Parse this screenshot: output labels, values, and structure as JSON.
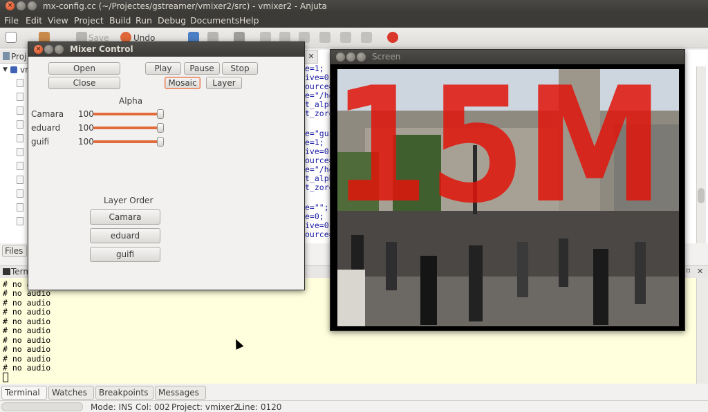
{
  "window": {
    "title": "mx-config.cc (~/Projectes/gstreamer/vmixer2/src) - vmixer2 - Anjuta"
  },
  "menu": [
    "File",
    "Edit",
    "View",
    "Project",
    "Build",
    "Run",
    "Debug",
    "Documents",
    "Help"
  ],
  "toolbar": {
    "save_label": "Save",
    "undo_label": "Undo"
  },
  "project_pane": {
    "header_label": "Proj",
    "root_label": "vm",
    "files_tab": "Files"
  },
  "editor": {
    "tab_close": "✕",
    "lines": [
      "e=1;",
      "ive=0;",
      "ource=",
      "e=\"/ho",
      "t_alph",
      "t_zoro",
      "",
      "e=\"gui",
      "e=1;",
      "ive=0;",
      "ource=",
      "e=\"/ho",
      "t_alph",
      "t_zoro",
      "",
      "e=\"\";",
      "e=0;",
      "ive=0;",
      "ource="
    ]
  },
  "terminal": {
    "header_label": "Termi",
    "lines": [
      "# no a",
      "# no audio",
      "# no audio",
      "# no audio",
      "# no audio",
      "# no audio",
      "# no audio",
      "# no audio",
      "# no audio",
      "# no audio"
    ]
  },
  "bottom_tabs": [
    "Terminal",
    "Watches",
    "Breakpoints",
    "Messages"
  ],
  "status": {
    "mode": "Mode: INS",
    "col": "Col: 002",
    "project": "Project: vmixer2",
    "line": "Line: 0120"
  },
  "mixer": {
    "title": "Mixer Control",
    "buttons": {
      "open": "Open",
      "close": "Close",
      "play": "Play",
      "pause": "Pause",
      "stop": "Stop",
      "mosaic": "Mosaic",
      "layer": "Layer"
    },
    "alpha_title": "Alpha",
    "channels": [
      {
        "name": "Camara",
        "value": "100",
        "level": 1.0
      },
      {
        "name": "eduard",
        "value": "100",
        "level": 1.0
      },
      {
        "name": "guifi",
        "value": "100",
        "level": 1.0
      }
    ],
    "layer_order_title": "Layer Order",
    "layers": [
      "Camara",
      "eduard",
      "guifi"
    ]
  },
  "screen": {
    "title": "Screen",
    "overlay_text": "15M"
  },
  "colors": {
    "accent": "#e26b3c",
    "overlay_red": "#e0140a",
    "terminal_bg": "#ffffdd"
  }
}
